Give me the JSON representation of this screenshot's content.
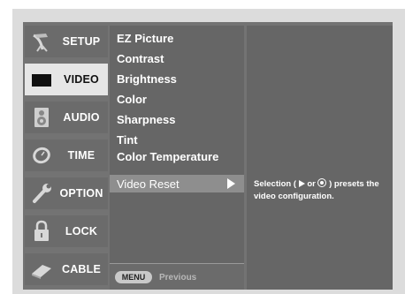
{
  "menu": {
    "items": [
      {
        "label": "SETUP",
        "icon": "satellite-dish-icon"
      },
      {
        "label": "VIDEO",
        "icon": "tv-screen-icon",
        "selected": true
      },
      {
        "label": "AUDIO",
        "icon": "speaker-icon"
      },
      {
        "label": "TIME",
        "icon": "clock-icon"
      },
      {
        "label": "OPTION",
        "icon": "wrench-icon"
      },
      {
        "label": "LOCK",
        "icon": "padlock-icon"
      },
      {
        "label": "CABLE",
        "icon": "cable-icon"
      }
    ]
  },
  "video_list": {
    "items": [
      {
        "label": "EZ Picture"
      },
      {
        "label": "Contrast"
      },
      {
        "label": "Brightness"
      },
      {
        "label": "Color"
      },
      {
        "label": "Sharpness"
      },
      {
        "label": "Tint"
      },
      {
        "label": "Color Temperature"
      },
      {
        "label": "Video Reset",
        "selected": true
      }
    ]
  },
  "footer": {
    "key": "MENU",
    "label": "Previous"
  },
  "help": {
    "prefix": "Selection (",
    "middle": " or ",
    "suffix": ") presets the video configuration."
  },
  "colors": {
    "frame": "#737373",
    "panel": "#666666",
    "selected_menu": "#e6e6e6",
    "selected_row": "#8e8e8e"
  }
}
